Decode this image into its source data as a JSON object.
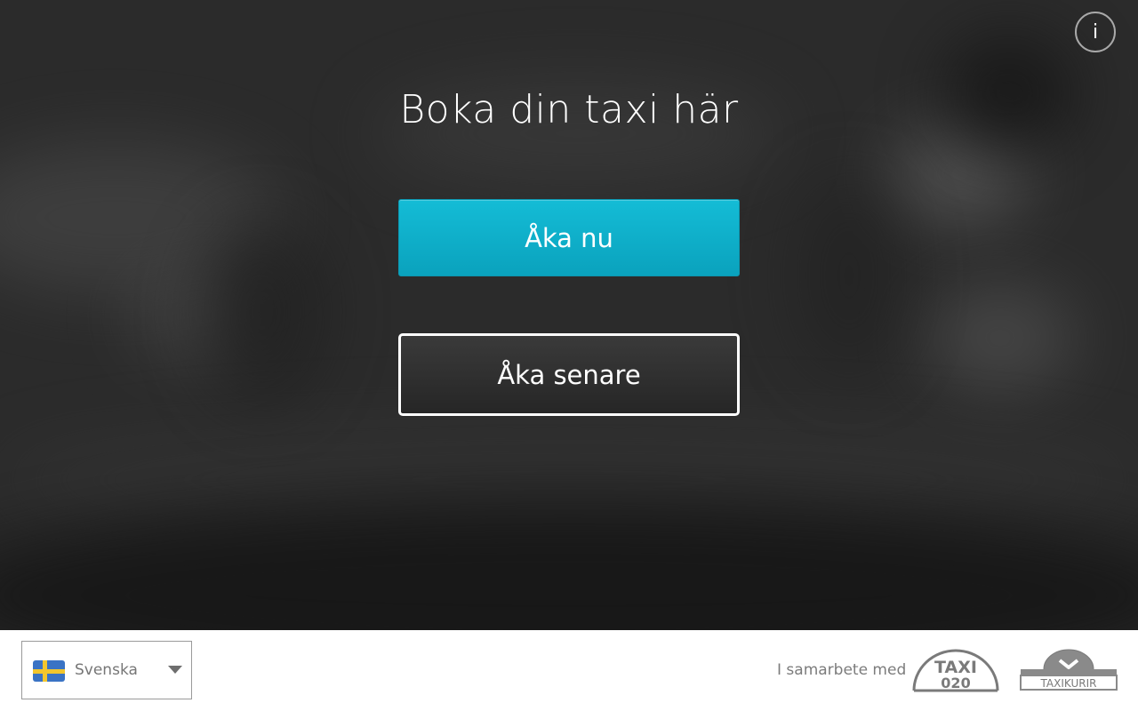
{
  "header": {
    "info_icon": "info-icon",
    "info_label": "i"
  },
  "main": {
    "title": "Boka din taxi här",
    "ride_now_label": "Åka nu",
    "ride_later_label": "Åka senare"
  },
  "footer": {
    "language": {
      "selected": "Svenska",
      "flag_icon": "swedish-flag-icon",
      "dropdown_icon": "chevron-down-icon"
    },
    "partner_text": "I samarbete med",
    "partners": [
      {
        "logo_text_top": "TAXI",
        "logo_text_bottom": "020"
      },
      {
        "logo_text": "TAXIKURIR"
      }
    ]
  },
  "colors": {
    "accent": "#10b4cf",
    "background": "#2b2b2b",
    "footer_bg": "#ffffff"
  }
}
